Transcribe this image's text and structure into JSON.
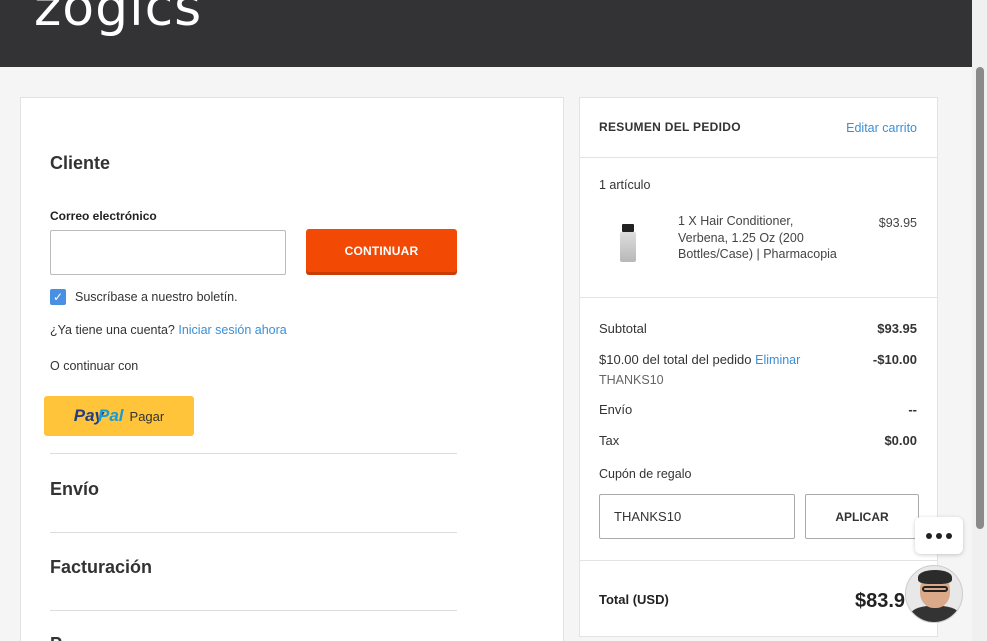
{
  "header": {
    "logo": "zogics"
  },
  "customer": {
    "title": "Cliente",
    "email_label": "Correo electrónico",
    "email_value": "",
    "continue_label": "CONTINUAR",
    "newsletter_label": "Suscríbase a nuestro boletín.",
    "newsletter_checked": true,
    "account_question": "¿Ya tiene una cuenta?",
    "login_link": "Iniciar sesión ahora",
    "continue_with": "O continuar con",
    "paypal_pay": "PayPal",
    "paypal_pay_part1": "Pay",
    "paypal_pay_part2": "Pal",
    "paypal_label": "Pagar"
  },
  "sections": {
    "shipping": "Envío",
    "billing": "Facturación",
    "payment_partial": "P"
  },
  "summary": {
    "title": "RESUMEN DEL PEDIDO",
    "edit_cart": "Editar carrito",
    "item_count": "1 artículo",
    "item": {
      "name": "1 X Hair Conditioner, Verbena, 1.25 Oz (200 Bottles/Case) | Pharmacopia",
      "price": "$93.95"
    },
    "subtotal_label": "Subtotal",
    "subtotal_value": "$93.95",
    "discount_label": "$10.00 del total del pedido",
    "discount_remove": "Eliminar",
    "discount_code": "THANKS10",
    "discount_value": "-$10.00",
    "shipping_label": "Envío",
    "shipping_value": "--",
    "tax_label": "Tax",
    "tax_value": "$0.00",
    "coupon_label": "Cupón de regalo",
    "coupon_value": "THANKS10",
    "apply_label": "APLICAR",
    "total_label": "Total (USD)",
    "total_value": "$83.9"
  },
  "colors": {
    "accent": "#f24a05",
    "link": "#3a8fd6",
    "paypal": "#ffc439",
    "header": "#333336"
  }
}
